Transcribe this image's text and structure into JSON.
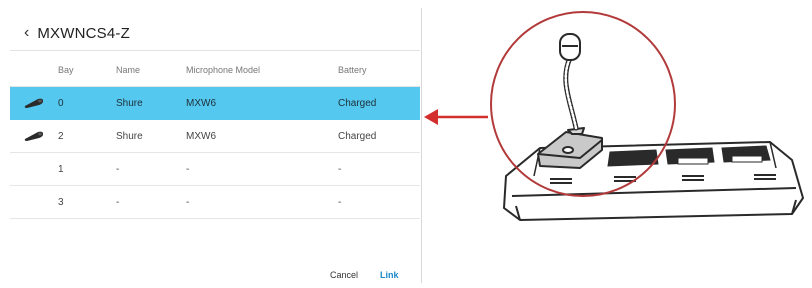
{
  "header": {
    "back_icon": "chevron-left-icon",
    "title": "MXWNCS4-Z"
  },
  "table": {
    "columns": {
      "bay": "Bay",
      "name": "Name",
      "model": "Microphone Model",
      "battery": "Battery"
    },
    "rows": [
      {
        "bay": "0",
        "name": "Shure",
        "model": "MXW6",
        "battery": "Charged",
        "has_mic": true,
        "selected": true
      },
      {
        "bay": "2",
        "name": "Shure",
        "model": "MXW6",
        "battery": "Charged",
        "has_mic": true,
        "selected": false
      },
      {
        "bay": "1",
        "name": "-",
        "model": "-",
        "battery": "-",
        "has_mic": false,
        "selected": false
      },
      {
        "bay": "3",
        "name": "-",
        "model": "-",
        "battery": "-",
        "has_mic": false,
        "selected": false
      }
    ],
    "selected_color": "#54c8ef"
  },
  "footer": {
    "cancel_label": "Cancel",
    "link_label": "Link",
    "link_color": "#1a88c8"
  },
  "illustration": {
    "icon": "charging-station-with-gooseneck-mic-icon",
    "arrow_color": "#d32f2f",
    "highlight_circle_color": "#b23a3a"
  }
}
